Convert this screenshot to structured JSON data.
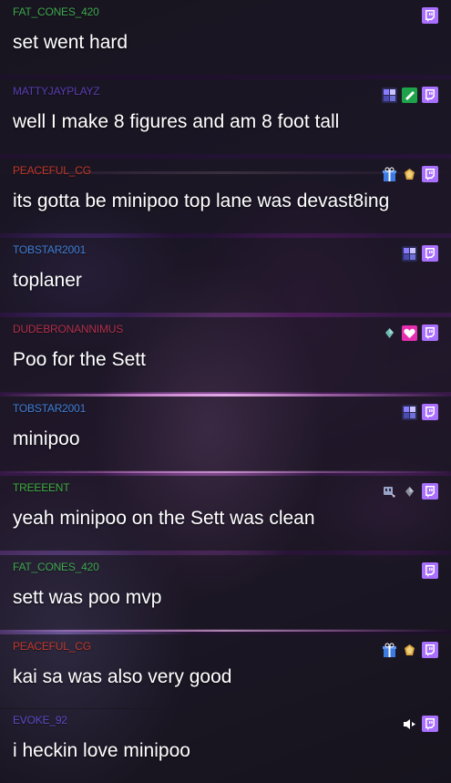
{
  "messages": [
    {
      "user": "FAT_CONES_420",
      "user_color": "#3fa84f",
      "text": "set went hard",
      "badges": []
    },
    {
      "user": "MATTYJAYPLAYZ",
      "user_color": "#5a3db5",
      "text": "well I make 8 figures and am 8 foot tall",
      "badges": [
        "sub-tier-badge",
        "check-badge"
      ]
    },
    {
      "user": "PEACEFUL_CG",
      "user_color": "#c0392b",
      "text": "its gotta be minipoo top lane was devast8ing",
      "badges": [
        "gift-badge",
        "cheer-badge"
      ]
    },
    {
      "user": "TOBSTAR2001",
      "user_color": "#3f7fd4",
      "text": "toplaner",
      "badges": [
        "sub-tier-badge"
      ]
    },
    {
      "user": "DUDEBRONANNIMUS",
      "user_color": "#b0304a",
      "text": "Poo for the Sett",
      "badges": [
        "bits-badge",
        "heart-badge"
      ]
    },
    {
      "user": "TOBSTAR2001",
      "user_color": "#3f7fd4",
      "text": "minipoo",
      "badges": [
        "sub-tier-badge"
      ]
    },
    {
      "user": "TREEEENT",
      "user_color": "#3fae3f",
      "text": "yeah minipoo on the Sett was clean",
      "badges": [
        "glitch-badge",
        "bits-badge"
      ]
    },
    {
      "user": "FAT_CONES_420",
      "user_color": "#3fa84f",
      "text": "sett was poo mvp",
      "badges": []
    },
    {
      "user": "PEACEFUL_CG",
      "user_color": "#c0392b",
      "text": "kai sa was also very good",
      "badges": [
        "gift-badge",
        "cheer-badge"
      ]
    },
    {
      "user": "EVOKE_92",
      "user_color": "#5b4bc4",
      "text": "i heckin love minipoo",
      "badges": [
        "speaker-badge"
      ]
    }
  ],
  "twitch_icon": "twitch-glitch-icon",
  "accent": "#a970ff"
}
